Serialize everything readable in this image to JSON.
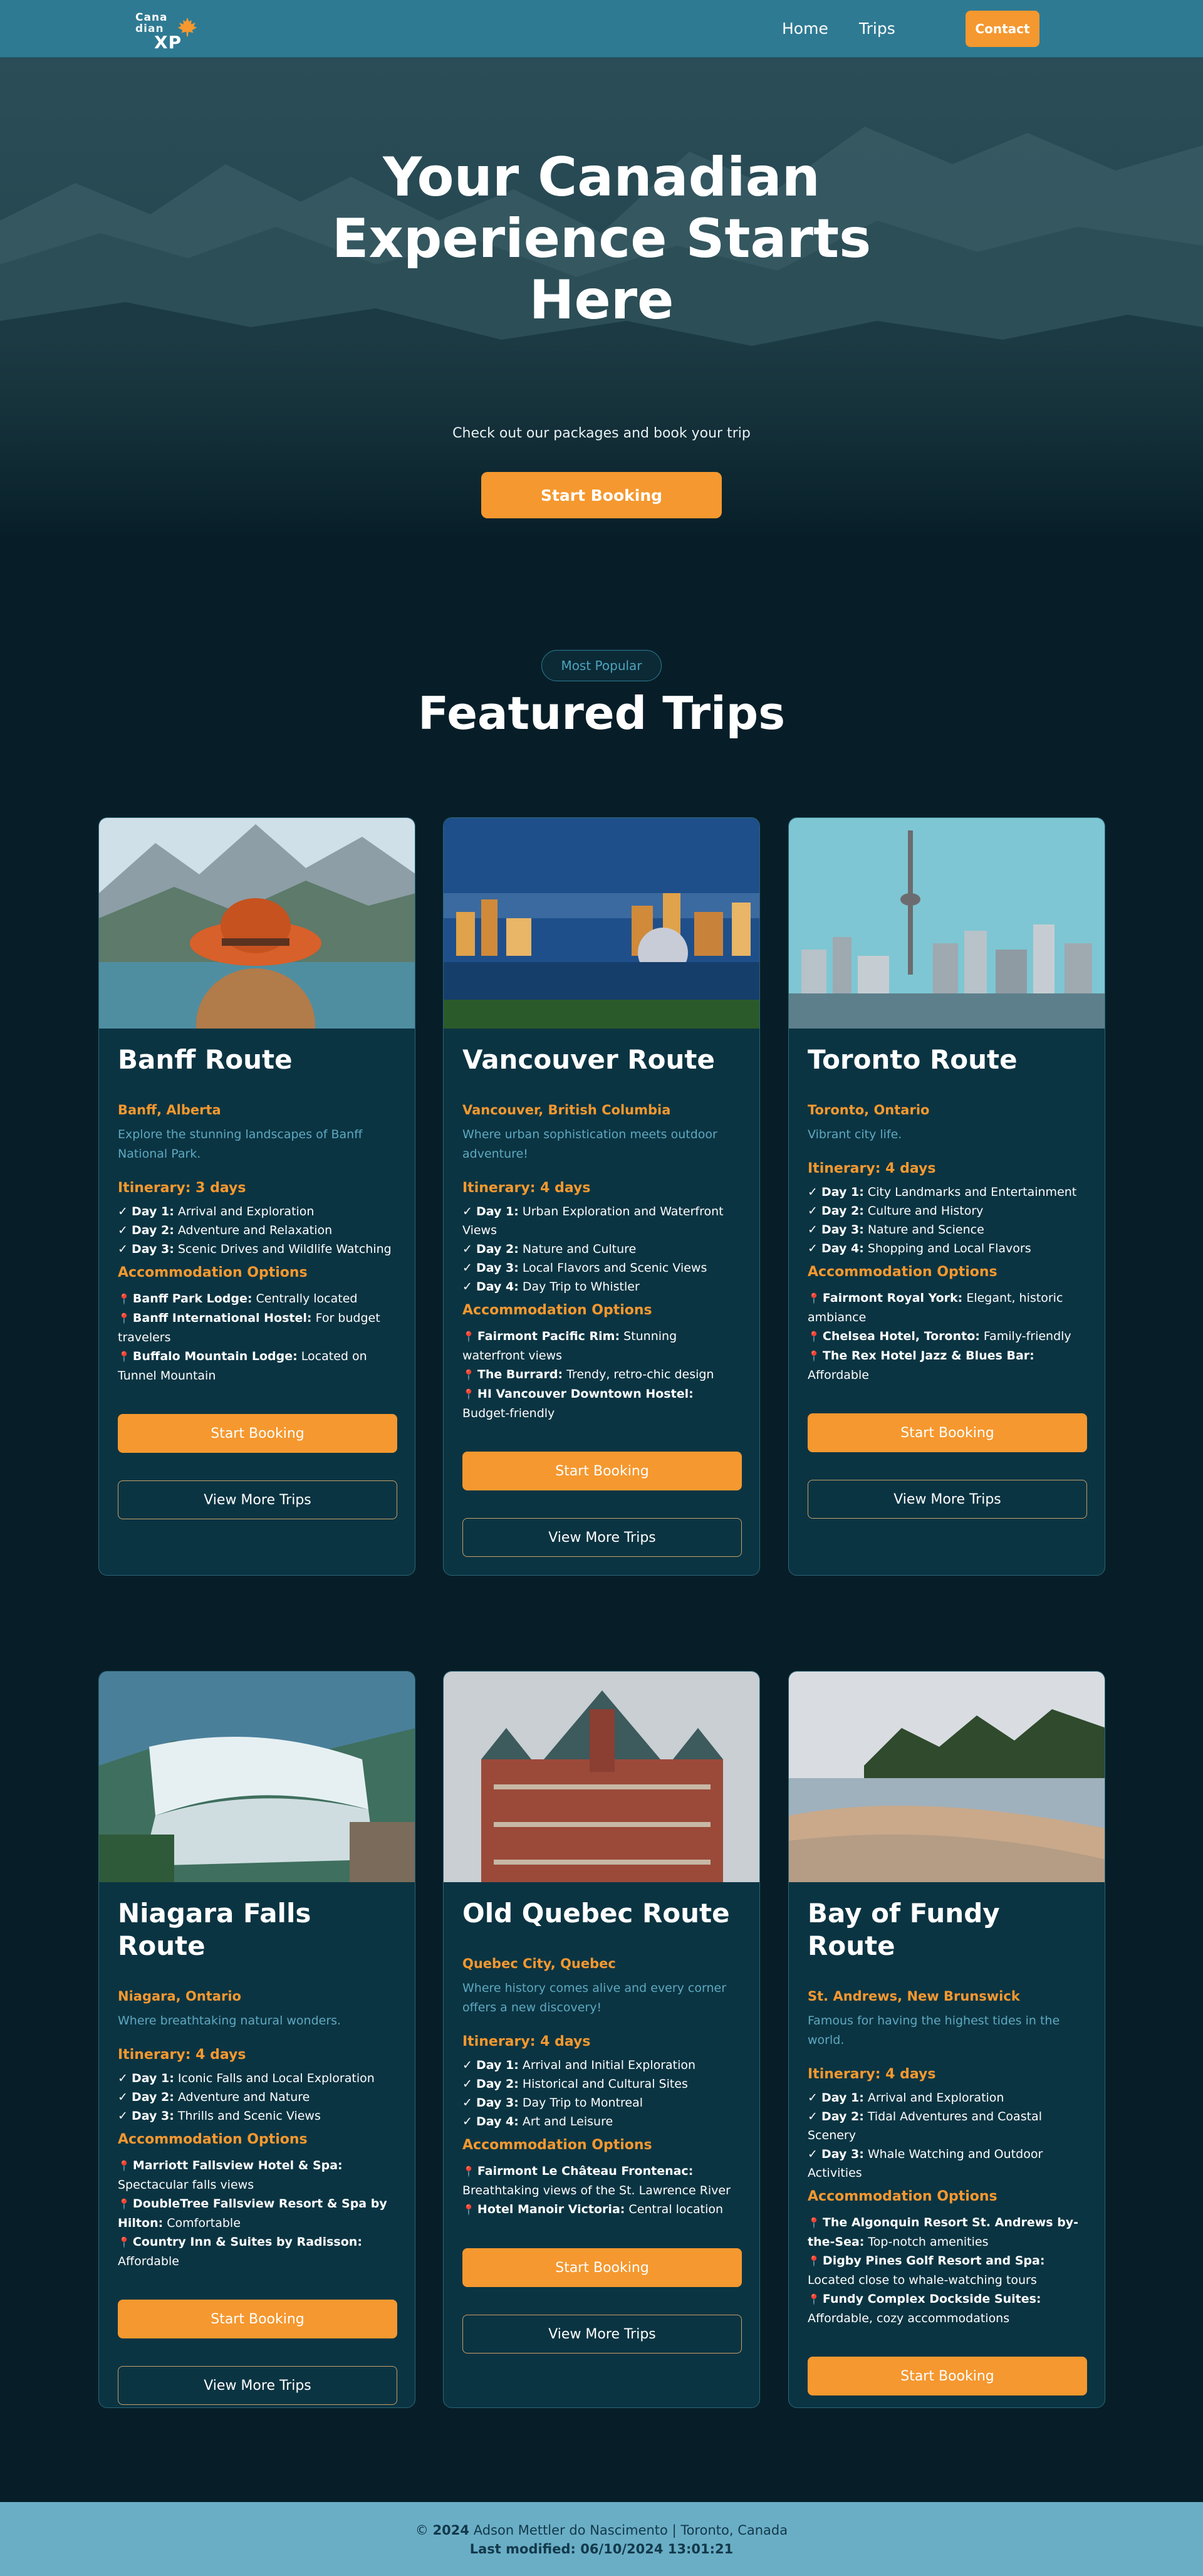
{
  "header": {
    "logo": {
      "line1": "Cana",
      "line2": "dian",
      "line3": "XP"
    },
    "nav": {
      "home": "Home",
      "trips": "Trips"
    },
    "contact": "Contact"
  },
  "hero": {
    "title": "Your Canadian Experience Starts Here",
    "subtitle": "Check out our packages and book your trip",
    "button": "Start Booking"
  },
  "featured": {
    "badge": "Most Popular",
    "title": "Featured Trips"
  },
  "labels": {
    "start_booking": "Start Booking",
    "view_more": "View More Trips",
    "accommodation": "Accommodation Options"
  },
  "trips": [
    {
      "title": "Banff Route",
      "location": "Banff, Alberta",
      "description": "Explore the stunning landscapes of Banff National Park.",
      "itinerary_title": "Itinerary: 3 days",
      "days": [
        {
          "label": "Day 1:",
          "text": "Arrival and Exploration"
        },
        {
          "label": "Day 2:",
          "text": "Adventure and Relaxation"
        },
        {
          "label": "Day 3:",
          "text": "Scenic Drives and Wildlife Watching"
        }
      ],
      "accommodations": [
        {
          "name": "Banff Park Lodge:",
          "text": "Centrally located"
        },
        {
          "name": "Banff International Hostel:",
          "text": "For budget travelers"
        },
        {
          "name": "Buffalo Mountain Lodge:",
          "text": "Located on Tunnel Mountain"
        }
      ]
    },
    {
      "title": "Vancouver Route",
      "location": "Vancouver, British Columbia",
      "description": "Where urban sophistication meets outdoor adventure!",
      "itinerary_title": "Itinerary: 4 days",
      "days": [
        {
          "label": "Day 1:",
          "text": "Urban Exploration and Waterfront Views"
        },
        {
          "label": "Day 2:",
          "text": "Nature and Culture"
        },
        {
          "label": "Day 3:",
          "text": "Local Flavors and Scenic Views"
        },
        {
          "label": "Day 4:",
          "text": "Day Trip to Whistler"
        }
      ],
      "accommodations": [
        {
          "name": "Fairmont Pacific Rim:",
          "text": "Stunning waterfront views"
        },
        {
          "name": "The Burrard:",
          "text": "Trendy, retro-chic design"
        },
        {
          "name": "HI Vancouver Downtown Hostel:",
          "text": "Budget-friendly"
        }
      ]
    },
    {
      "title": "Toronto Route",
      "location": "Toronto, Ontario",
      "description": "Vibrant city life.",
      "itinerary_title": "Itinerary: 4 days",
      "days": [
        {
          "label": "Day 1:",
          "text": "City Landmarks and Entertainment"
        },
        {
          "label": "Day 2:",
          "text": "Culture and History"
        },
        {
          "label": "Day 3:",
          "text": "Nature and Science"
        },
        {
          "label": "Day 4:",
          "text": "Shopping and Local Flavors"
        }
      ],
      "accommodations": [
        {
          "name": "Fairmont Royal York:",
          "text": "Elegant, historic ambiance"
        },
        {
          "name": "Chelsea Hotel, Toronto:",
          "text": "Family-friendly"
        },
        {
          "name": "The Rex Hotel Jazz & Blues Bar:",
          "text": "Affordable"
        }
      ]
    },
    {
      "title": "Niagara Falls Route",
      "location": "Niagara, Ontario",
      "description": "Where breathtaking natural wonders.",
      "itinerary_title": "Itinerary: 4 days",
      "days": [
        {
          "label": "Day 1:",
          "text": "Iconic Falls and Local Exploration"
        },
        {
          "label": "Day 2:",
          "text": "Adventure and Nature"
        },
        {
          "label": "Day 3:",
          "text": "Thrills and Scenic Views"
        }
      ],
      "accommodations": [
        {
          "name": "Marriott Fallsview Hotel & Spa:",
          "text": "Spectacular falls views"
        },
        {
          "name": "DoubleTree Fallsview Resort & Spa by Hilton:",
          "text": "Comfortable"
        },
        {
          "name": "Country Inn & Suites by Radisson:",
          "text": "Affordable"
        }
      ]
    },
    {
      "title": "Old Quebec Route",
      "location": "Quebec City, Quebec",
      "description": "Where history comes alive and every corner offers a new discovery!",
      "itinerary_title": "Itinerary: 4 days",
      "days": [
        {
          "label": "Day 1:",
          "text": "Arrival and Initial Exploration"
        },
        {
          "label": "Day 2:",
          "text": "Historical and Cultural Sites"
        },
        {
          "label": "Day 3:",
          "text": "Day Trip to Montreal"
        },
        {
          "label": "Day 4:",
          "text": "Art and Leisure"
        }
      ],
      "accommodations": [
        {
          "name": "Fairmont Le Château Frontenac:",
          "text": "Breathtaking views of the St. Lawrence River"
        },
        {
          "name": "Hotel Manoir Victoria:",
          "text": "Central location"
        }
      ]
    },
    {
      "title": "Bay of Fundy Route",
      "location": "St. Andrews, New Brunswick",
      "description": "Famous for having the highest tides in the world.",
      "itinerary_title": "Itinerary: 4 days",
      "days": [
        {
          "label": "Day 1:",
          "text": "Arrival and Exploration"
        },
        {
          "label": "Day 2:",
          "text": "Tidal Adventures and Coastal Scenery"
        },
        {
          "label": "Day 3:",
          "text": "Whale Watching and Outdoor Activities"
        }
      ],
      "accommodations": [
        {
          "name": "The Algonquin Resort St. Andrews by-the-Sea:",
          "text": "Top-notch amenities"
        },
        {
          "name": "Digby Pines Golf Resort and Spa:",
          "text": "Located close to whale-watching tours"
        },
        {
          "name": "Fundy Complex Dockside Suites:",
          "text": "Affordable, cozy accommodations"
        }
      ]
    }
  ],
  "footer": {
    "copyright_symbol": "©",
    "year": "2024",
    "author": "Adson Mettler do Nascimento | Toronto, Canada",
    "last_modified": "Last modified: 06/10/2024 13:01:21"
  },
  "colors": {
    "accent": "#f5982f",
    "header": "#2f7a93",
    "card": "#0b3442",
    "page": "#071e28",
    "footer": "#6aaec6"
  }
}
